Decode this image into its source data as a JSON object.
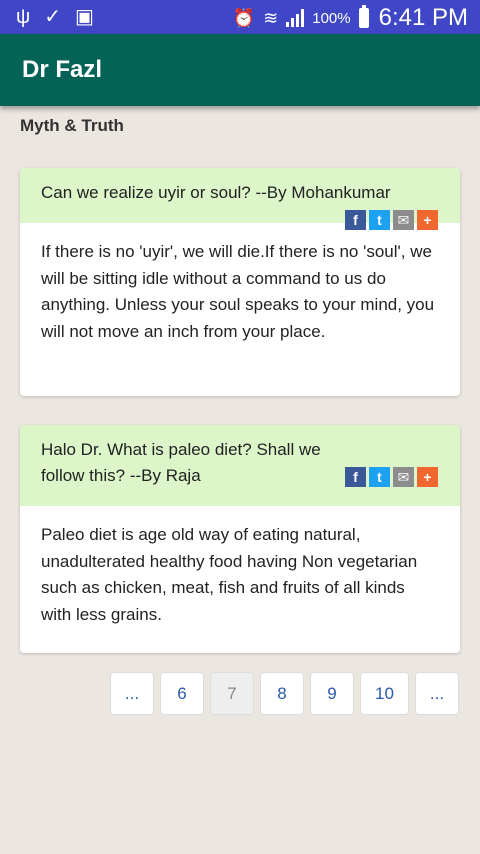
{
  "status_bar": {
    "left_icons": [
      "usb-icon",
      "check-icon",
      "image-icon"
    ],
    "battery_percent": "100%",
    "time": "6:41 PM"
  },
  "app_bar": {
    "title": "Dr Fazl"
  },
  "section": {
    "title": "Myth & Truth"
  },
  "posts": [
    {
      "question": "Can we realize uyir or soul? --By Mohankumar",
      "answer": "If there is no 'uyir', we will die.If there is no 'soul', we will be sitting idle without a command to us do anything. Unless your soul speaks to your mind, you will not move an inch from your place."
    },
    {
      "question": "Halo Dr. What is paleo diet? Shall we follow this? --By Raja",
      "answer": "Paleo diet is age old way of eating natural, unadulterated healthy food having Non vegetarian such as chicken, meat, fish and fruits of all kinds with less grains."
    }
  ],
  "share_icons": [
    "f",
    "t",
    "✉",
    "+"
  ],
  "pagination": {
    "pages": [
      "...",
      "6",
      "7",
      "8",
      "9",
      "10",
      "..."
    ],
    "current": "7"
  }
}
